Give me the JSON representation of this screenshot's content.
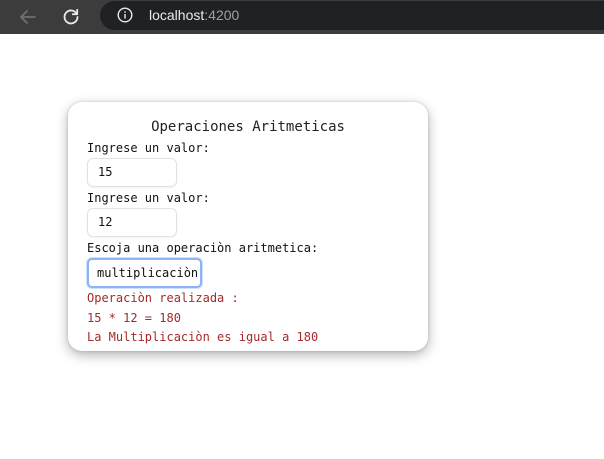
{
  "browser": {
    "url_host": "localhost",
    "url_port": ":4200"
  },
  "form": {
    "title": "Operaciones Aritmeticas",
    "value1_label": "Ingrese un valor:",
    "value1": "15",
    "value2_label": "Ingrese un valor:",
    "value2": "12",
    "operation_label": "Escoja una operaciòn aritmetica:",
    "operation_selected": "multiplicaciòn"
  },
  "result": {
    "heading": "Operaciòn realizada :",
    "expression": "15 * 12 = 180",
    "message": "La Multiplicaciòn es igual a 180"
  },
  "colors": {
    "result_text": "#a52a2a",
    "focus_ring": "#8ab4f8",
    "browser_bar": "#3c3c3c"
  }
}
